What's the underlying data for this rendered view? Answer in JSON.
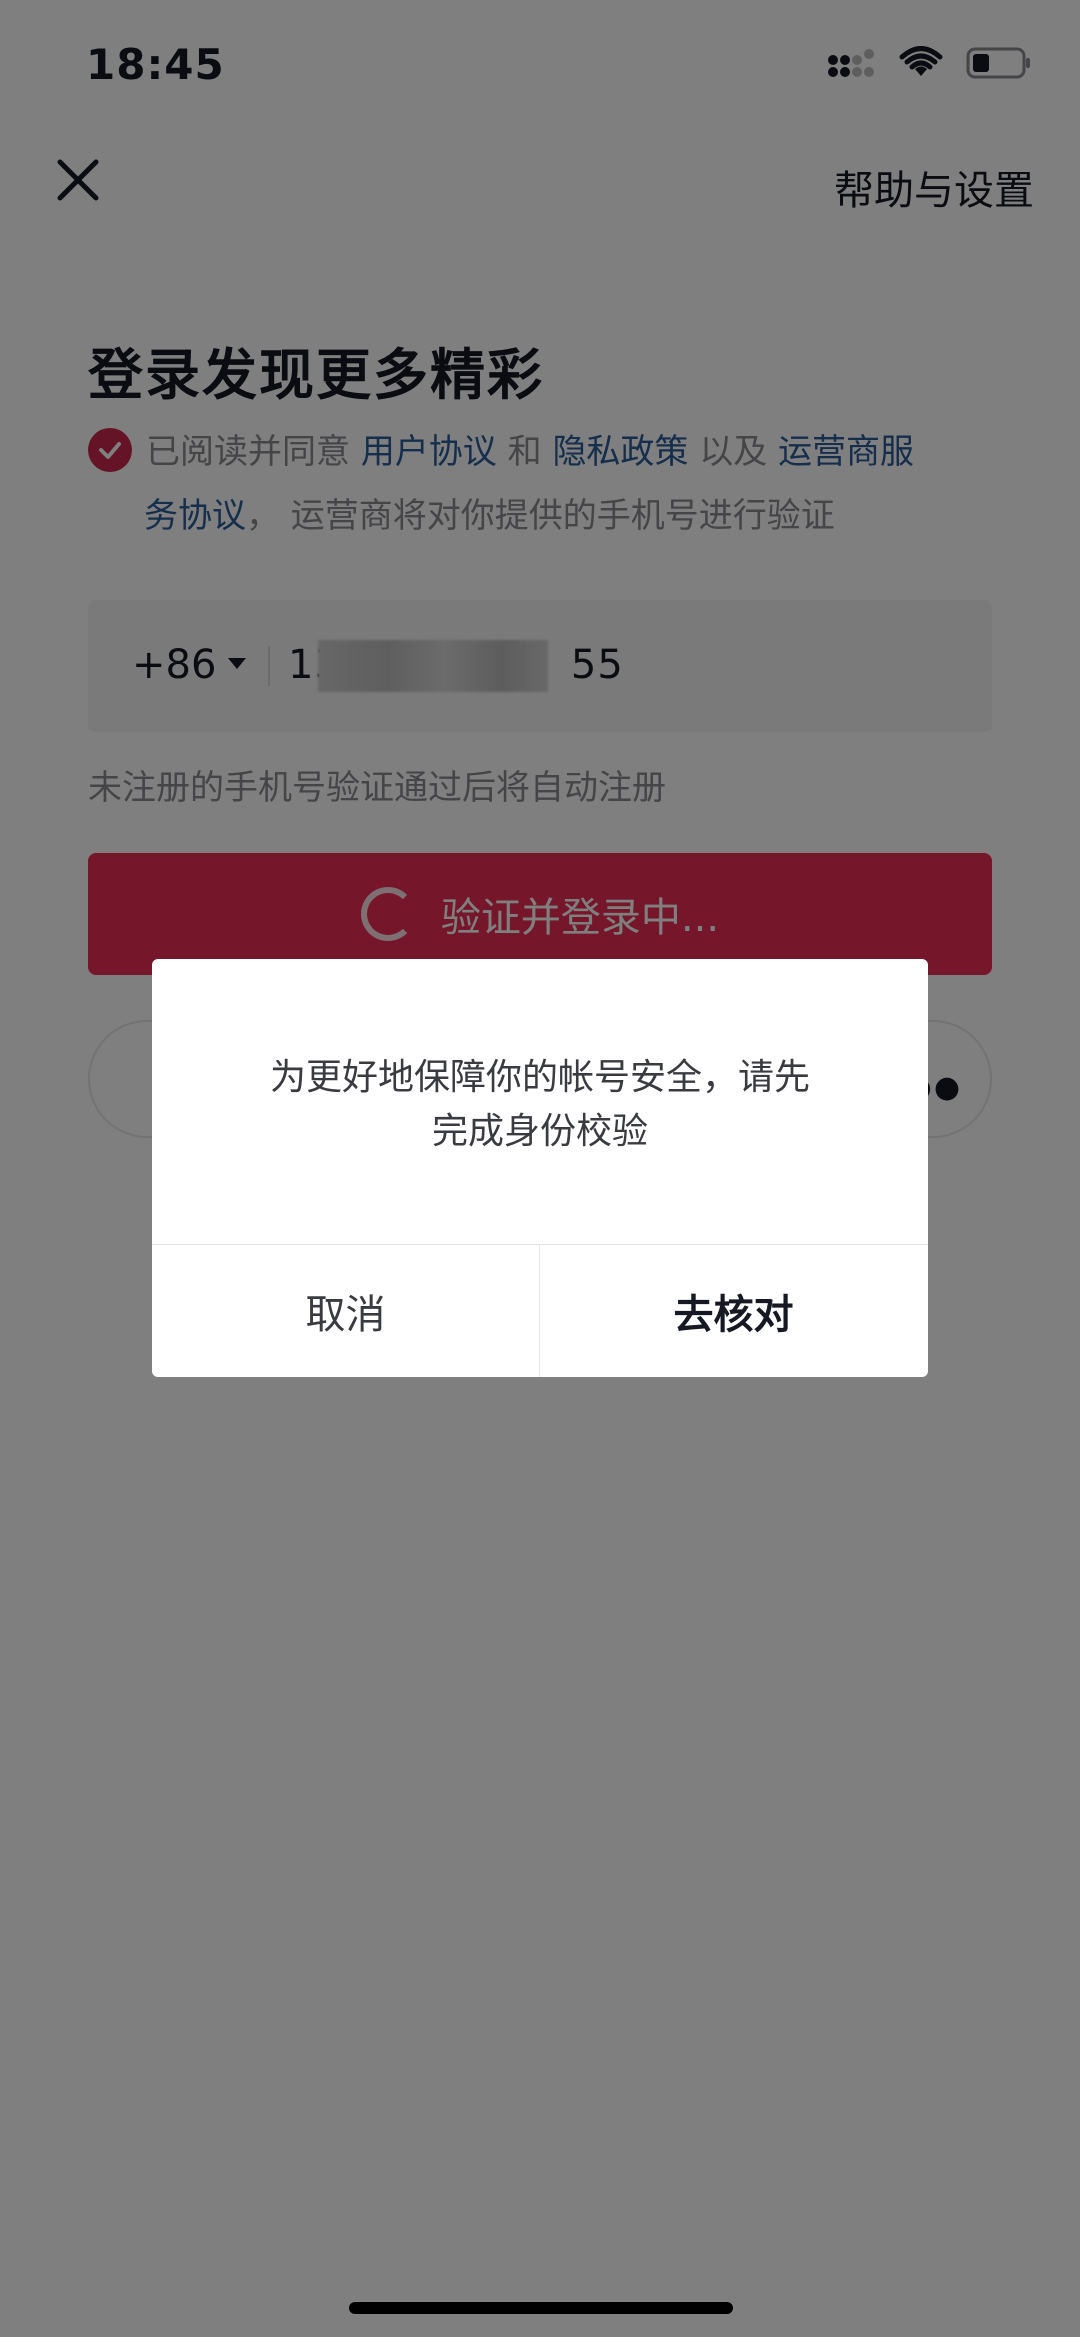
{
  "status_bar": {
    "time": "18:45",
    "icons": [
      "signal-icon",
      "wifi-icon",
      "battery-icon"
    ]
  },
  "header": {
    "close_icon": "close-icon",
    "help_label": "帮助与设置"
  },
  "title": "登录发现更多精彩",
  "agreement": {
    "checked": true,
    "prefix": "已阅读并同意",
    "user_agreement": "用户协议",
    "and": "和",
    "privacy_policy": "隐私政策",
    "and_also": "以及",
    "carrier_agreement_1": "运营商服",
    "carrier_agreement_2": "务协议",
    "suffix": "， 运营商将对你提供的手机号进行验证"
  },
  "phone": {
    "country_code": "+86",
    "prefix": "13",
    "suffix": "55"
  },
  "hint": "未注册的手机号验证通过后将自动注册",
  "login_button": {
    "label": "验证并登录中...",
    "loading": true
  },
  "dialog": {
    "message_line1": "为更好地保障你的帐号安全，请先",
    "message_line2": "完成身份校验",
    "cancel_label": "取消",
    "confirm_label": "去核对"
  },
  "colors": {
    "accent": "#ec2c55",
    "link": "#2b5c99",
    "overlay": "rgba(0,0,0,0.5)"
  }
}
